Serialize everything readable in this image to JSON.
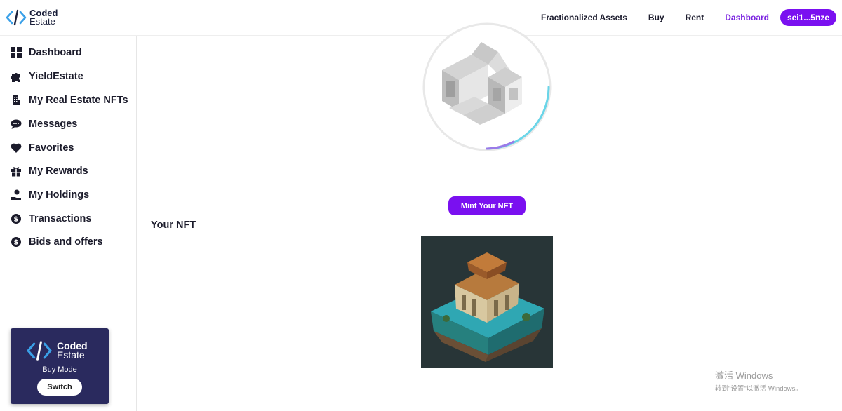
{
  "brand": {
    "line1": "Coded",
    "line2": "Estate"
  },
  "nav": {
    "items": [
      {
        "label": "Fractionalized Assets",
        "active": false
      },
      {
        "label": "Buy",
        "active": false
      },
      {
        "label": "Rent",
        "active": false
      },
      {
        "label": "Dashboard",
        "active": true
      }
    ],
    "wallet": "sei1...5nze"
  },
  "sidebar": {
    "items": [
      {
        "label": "Dashboard",
        "icon": "grid-icon"
      },
      {
        "label": "YieldEstate",
        "icon": "puzzle-icon"
      },
      {
        "label": "My Real Estate NFTs",
        "icon": "building-icon"
      },
      {
        "label": "Messages",
        "icon": "chat-icon"
      },
      {
        "label": "Favorites",
        "icon": "heart-icon"
      },
      {
        "label": "My Rewards",
        "icon": "gift-icon"
      },
      {
        "label": "My Holdings",
        "icon": "hand-coin-icon"
      },
      {
        "label": "Transactions",
        "icon": "dollar-circle-icon"
      },
      {
        "label": "Bids and offers",
        "icon": "dollar-circle-icon"
      }
    ],
    "mode_card": {
      "brand1": "Coded",
      "brand2": "Estate",
      "mode": "Buy Mode",
      "switch": "Switch"
    }
  },
  "main": {
    "mint_button": "Mint Your NFT",
    "your_nft": "Your NFT"
  },
  "watermark": {
    "line1": "激活 Windows",
    "line2": "转到\"设置\"以激活 Windows。"
  },
  "colors": {
    "accent": "#7a10f0",
    "active_nav": "#7a22e0",
    "card_bg": "#2a2a5e"
  }
}
